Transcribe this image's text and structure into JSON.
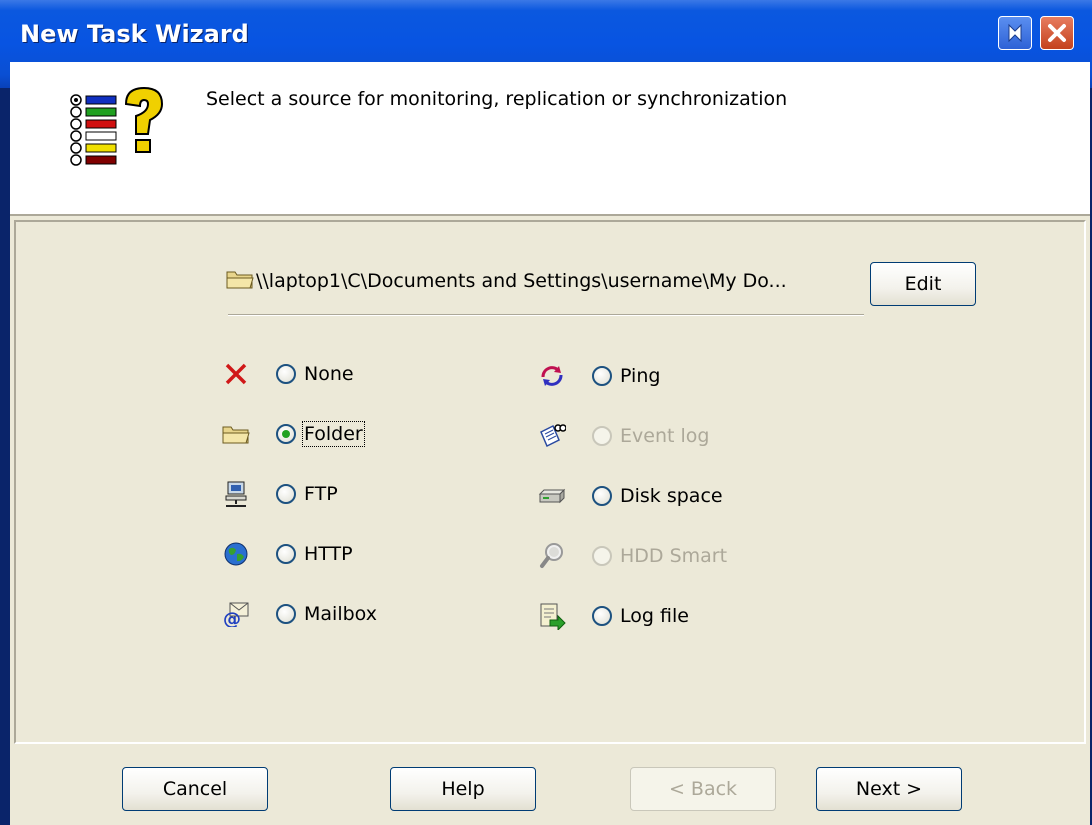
{
  "window": {
    "title": "New Task Wizard"
  },
  "header": {
    "text": "Select a source for monitoring, replication or synchronization"
  },
  "source": {
    "path": "\\\\laptop1\\C\\Documents and Settings\\username\\My Do...",
    "edit_label": "Edit"
  },
  "options_left": [
    {
      "label": "None",
      "icon": "red-x-icon",
      "checked": false,
      "enabled": true
    },
    {
      "label": "Folder",
      "icon": "folder-icon",
      "checked": true,
      "enabled": true
    },
    {
      "label": "FTP",
      "icon": "network-computer-icon",
      "checked": false,
      "enabled": true
    },
    {
      "label": "HTTP",
      "icon": "globe-icon",
      "checked": false,
      "enabled": true
    },
    {
      "label": "Mailbox",
      "icon": "mail-icon",
      "checked": false,
      "enabled": true
    }
  ],
  "options_right": [
    {
      "label": "Ping",
      "icon": "ping-icon",
      "checked": false,
      "enabled": true
    },
    {
      "label": "Event log",
      "icon": "event-log-icon",
      "checked": false,
      "enabled": false
    },
    {
      "label": "Disk space",
      "icon": "disk-icon",
      "checked": false,
      "enabled": true
    },
    {
      "label": "HDD Smart",
      "icon": "hdd-smart-icon",
      "checked": false,
      "enabled": false
    },
    {
      "label": "Log file",
      "icon": "log-file-icon",
      "checked": false,
      "enabled": true
    }
  ],
  "buttons": {
    "cancel": "Cancel",
    "help": "Help",
    "back": "< Back",
    "next": "Next >"
  },
  "colors": {
    "titlebar": "#0854e2",
    "dialog_bg": "#ece9d8",
    "checked_dot": "#21a121",
    "close_button": "#c4421d"
  }
}
